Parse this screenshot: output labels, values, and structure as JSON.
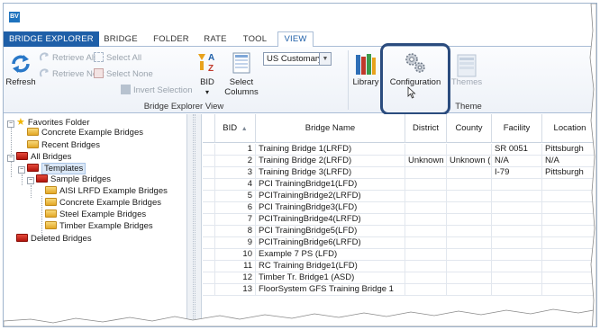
{
  "app": {
    "icon_text": "BV"
  },
  "tabs": [
    {
      "label": "BRIDGE EXPLORER"
    },
    {
      "label": "BRIDGE"
    },
    {
      "label": "FOLDER"
    },
    {
      "label": "RATE"
    },
    {
      "label": "TOOL"
    },
    {
      "label": "VIEW"
    }
  ],
  "ribbon": {
    "refresh": "Refresh",
    "retrieve_all": "Retrieve All",
    "retrieve_next": "Retrieve Next",
    "select_all": "Select All",
    "select_none": "Select None",
    "invert_selection": "Invert Selection",
    "bid": "BID",
    "bid_arrow": "▾",
    "select_columns_1": "Select",
    "select_columns_2": "Columns",
    "units_value": "US Customary",
    "library": "Library",
    "configuration": "Configuration",
    "themes": "Themes",
    "group_explorer_view": "Bridge Explorer View",
    "group_theme": "Theme"
  },
  "tree": {
    "favorites": "Favorites Folder",
    "concrete_examples_fav": "Concrete Example Bridges",
    "recent": "Recent Bridges",
    "all": "All Bridges",
    "templates": "Templates",
    "sample": "Sample Bridges",
    "aisi": "AISI LRFD Example Bridges",
    "concrete": "Concrete Example Bridges",
    "steel": "Steel Example Bridges",
    "timber": "Timber Example Bridges",
    "deleted": "Deleted Bridges"
  },
  "grid": {
    "headers": {
      "bid": "BID",
      "sort": "▲",
      "name": "Bridge Name",
      "district": "District",
      "county": "County",
      "facility": "Facility",
      "location": "Location"
    },
    "rows": [
      {
        "bid": "1",
        "name": "Training Bridge 1(LRFD)",
        "district": "",
        "county": "",
        "facility": "SR 0051",
        "location": "Pittsburgh"
      },
      {
        "bid": "2",
        "name": "Training Bridge 2(LRFD)",
        "district": "Unknown",
        "county": "Unknown (F",
        "facility": "N/A",
        "location": "N/A"
      },
      {
        "bid": "3",
        "name": "Training Bridge 3(LRFD)",
        "district": "",
        "county": "",
        "facility": "I-79",
        "location": "Pittsburgh"
      },
      {
        "bid": "4",
        "name": "PCI TrainingBridge1(LFD)",
        "district": "",
        "county": "",
        "facility": "",
        "location": ""
      },
      {
        "bid": "5",
        "name": "PCITrainingBridge2(LRFD)",
        "district": "",
        "county": "",
        "facility": "",
        "location": ""
      },
      {
        "bid": "6",
        "name": "PCI TrainingBridge3(LFD)",
        "district": "",
        "county": "",
        "facility": "",
        "location": ""
      },
      {
        "bid": "7",
        "name": "PCITrainingBridge4(LRFD)",
        "district": "",
        "county": "",
        "facility": "",
        "location": ""
      },
      {
        "bid": "8",
        "name": "PCI TrainingBridge5(LFD)",
        "district": "",
        "county": "",
        "facility": "",
        "location": ""
      },
      {
        "bid": "9",
        "name": "PCITrainingBridge6(LRFD)",
        "district": "",
        "county": "",
        "facility": "",
        "location": ""
      },
      {
        "bid": "10",
        "name": "Example 7 PS (LFD)",
        "district": "",
        "county": "",
        "facility": "",
        "location": ""
      },
      {
        "bid": "11",
        "name": "RC Training Bridge1(LFD)",
        "district": "",
        "county": "",
        "facility": "",
        "location": ""
      },
      {
        "bid": "12",
        "name": "Timber Tr. Bridge1 (ASD)",
        "district": "",
        "county": "",
        "facility": "",
        "location": ""
      },
      {
        "bid": "13",
        "name": "FloorSystem GFS Training Bridge 1",
        "district": "",
        "county": "",
        "facility": "",
        "location": ""
      }
    ]
  },
  "colors": {
    "accent": "#1e5fa8",
    "highlight_border": "#2b4c7e",
    "selection": "#dbe8f7"
  }
}
